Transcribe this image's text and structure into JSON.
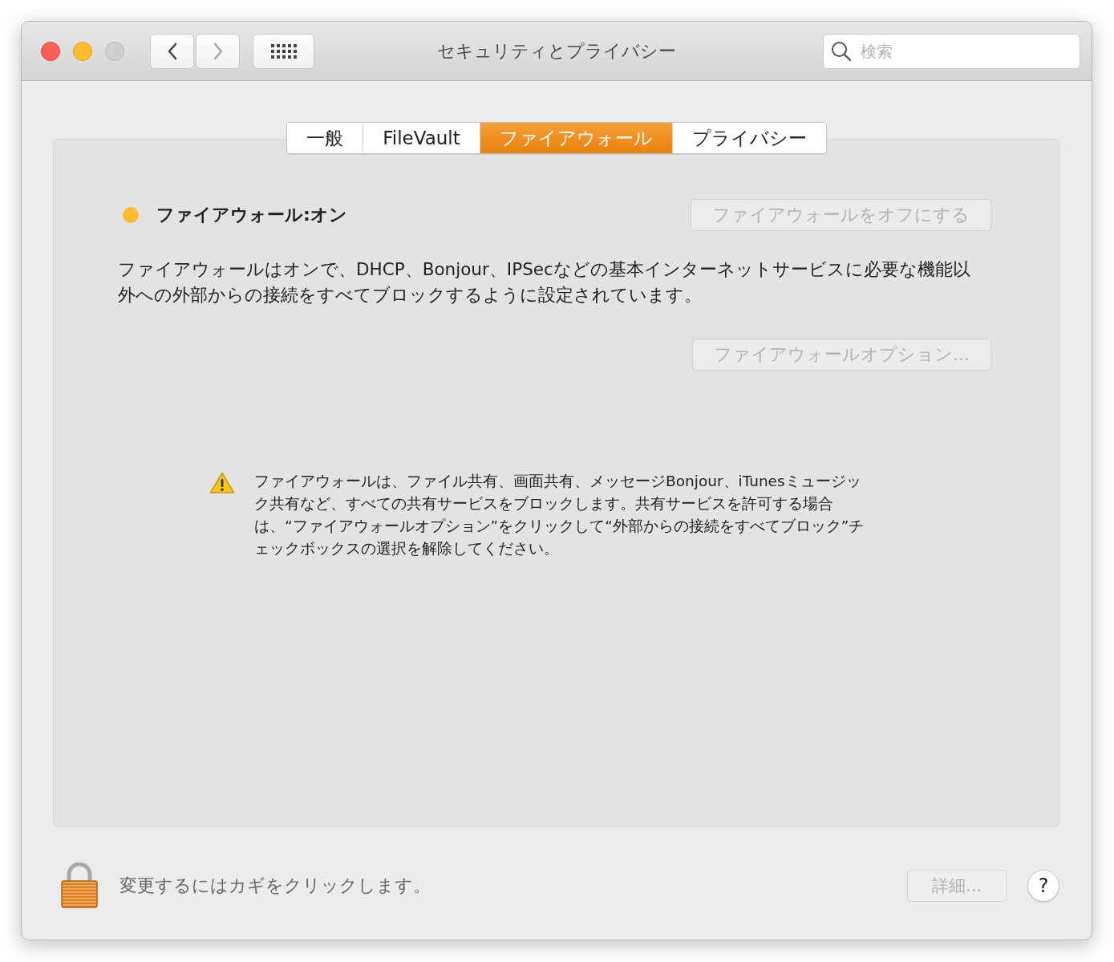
{
  "window": {
    "title": "セキュリティとプライバシー",
    "controls": [
      {
        "kind": "close",
        "disabled": false
      },
      {
        "kind": "minimize",
        "disabled": false
      },
      {
        "kind": "zoom",
        "disabled": true
      }
    ]
  },
  "toolbar": {
    "back": {
      "disabled": false
    },
    "forward": {
      "disabled": true
    },
    "search": {
      "placeholder": "検索"
    }
  },
  "tabs": [
    {
      "label": "一般",
      "selected": false
    },
    {
      "label": "FileVault",
      "selected": false
    },
    {
      "label": "ファイアウォール",
      "selected": true
    },
    {
      "label": "プライバシー",
      "selected": false
    }
  ],
  "firewall": {
    "status": "ファイアウォール:オン",
    "color": "#febc2e",
    "toggle_button": {
      "label": "ファイアウォールをオフにする",
      "disabled": true
    },
    "description": "ファイアウォールはオンで、DHCP、Bonjour、IPSecなどの基本インターネットサービスに必要な機能以外への外部からの接続をすべてブロックするように設定されています。",
    "options_button": {
      "label": "ファイアウォールオプション...",
      "disabled": true
    },
    "warning": "ファイアウォールは、ファイル共有、画面共有、メッセージBonjour、iTunesミュージック共有など、すべての共有サービスをブロックします。共有サービスを許可する場合は、“ファイアウォールオプション”をクリックして“外部からの接続をすべてブロック”チェックボックスの選択を解除してください。"
  },
  "footer": {
    "lock_text": "変更するにはカギをクリックします。",
    "details_button": {
      "label": "詳細...",
      "disabled": true
    },
    "help_button": {
      "label": "?"
    }
  }
}
